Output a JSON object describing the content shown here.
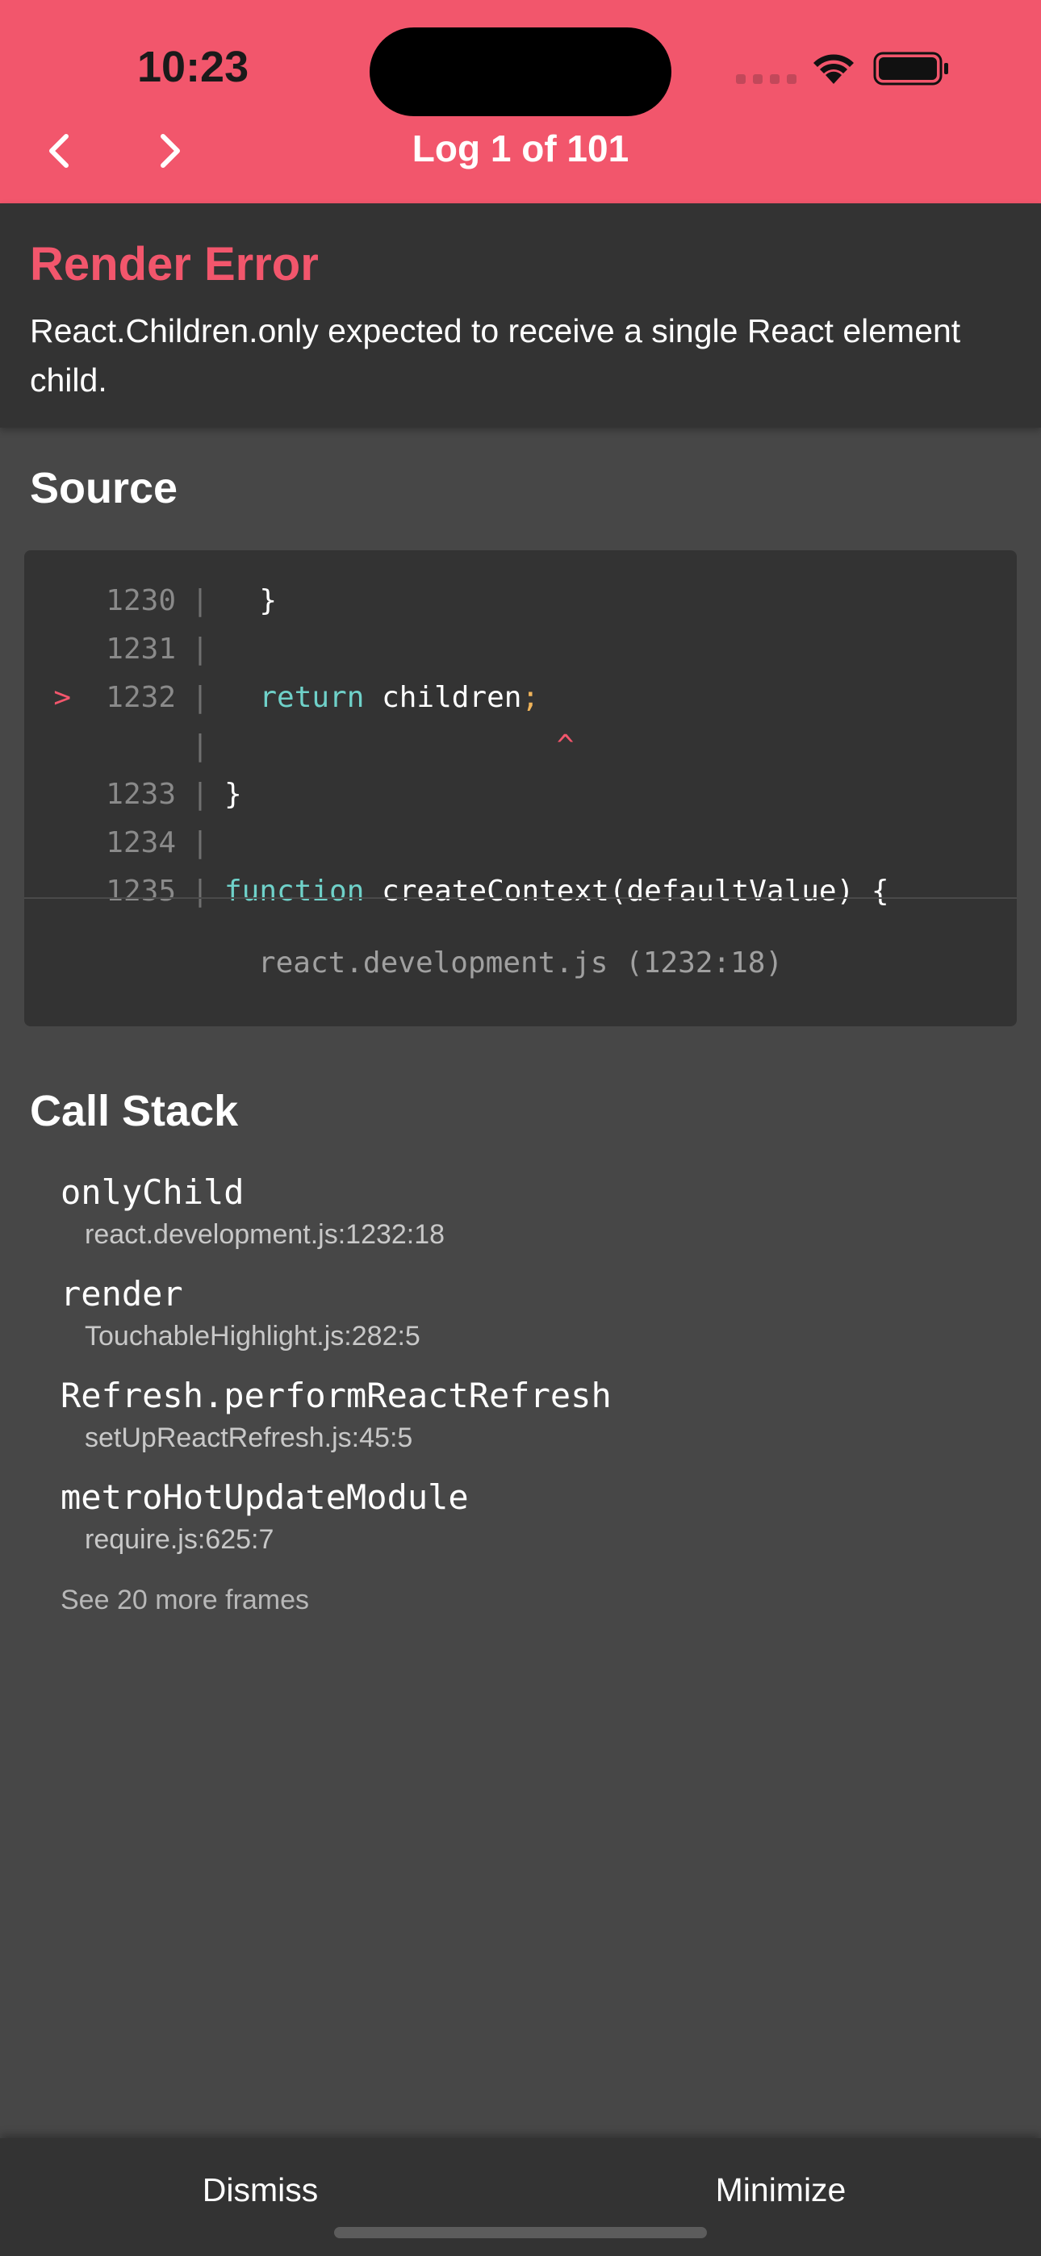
{
  "status_bar": {
    "time": "10:23"
  },
  "header": {
    "title": "Log 1 of 101",
    "background": "#f2566c"
  },
  "error": {
    "title": "Render Error",
    "message": "React.Children.only expected to receive a single React element child."
  },
  "source": {
    "title": "Source",
    "lines": [
      {
        "marker": "",
        "number": "1230",
        "code": "  }"
      },
      {
        "marker": "",
        "number": "1231",
        "code": ""
      },
      {
        "marker": ">",
        "number": "1232",
        "code_keyword": "  return",
        "code_rest": " children",
        "code_punc": ";"
      },
      {
        "marker": "",
        "number": "",
        "caret": "                   ^"
      },
      {
        "marker": "",
        "number": "1233",
        "code": "}"
      },
      {
        "marker": "",
        "number": "1234",
        "code": ""
      },
      {
        "marker": "",
        "number": "1235",
        "code_keyword": "function",
        "code_rest": " createContext(defaultValue) {"
      }
    ],
    "file": "react.development.js (1232:18)"
  },
  "call_stack": {
    "title": "Call Stack",
    "frames": [
      {
        "name": "onlyChild",
        "location": "react.development.js:1232:18"
      },
      {
        "name": "render",
        "location": "TouchableHighlight.js:282:5"
      },
      {
        "name": "Refresh.performReactRefresh",
        "location": "setUpReactRefresh.js:45:5"
      },
      {
        "name": "metroHotUpdateModule",
        "location": "require.js:625:7"
      }
    ],
    "more": "See 20 more frames"
  },
  "footer": {
    "dismiss_label": "Dismiss",
    "minimize_label": "Minimize"
  }
}
